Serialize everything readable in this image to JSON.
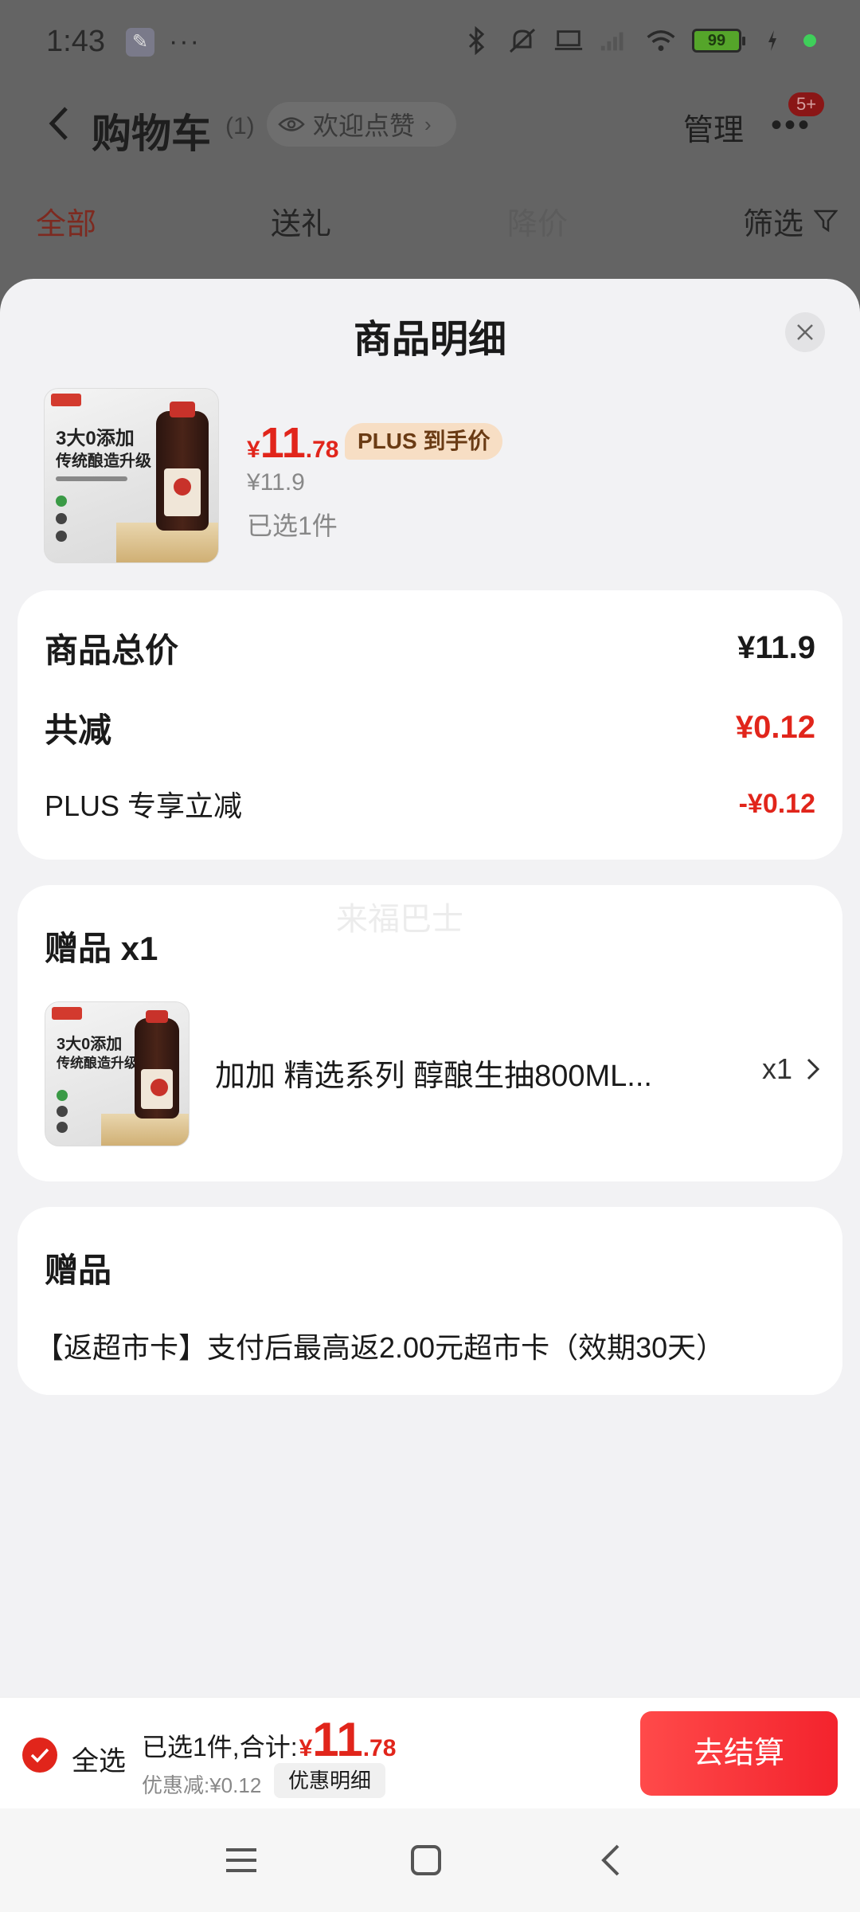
{
  "status_bar": {
    "time": "1:43",
    "battery": "99"
  },
  "nav": {
    "title": "购物车",
    "count": "(1)",
    "welcome": "欢迎点赞",
    "manage": "管理",
    "badge": "5+"
  },
  "tabs": {
    "all": "全部",
    "gift": "送礼",
    "price_drop": "降价",
    "filter": "筛选"
  },
  "sheet": {
    "title": "商品明细",
    "product": {
      "price_symbol": "¥",
      "price_int": "11",
      "price_dec": ".78",
      "plus_tag": "PLUS 到手价",
      "original_price": "¥11.9",
      "selected": "已选1件",
      "image_text_1": "3大0添加",
      "image_text_2": "传统酿造升级"
    },
    "summary": {
      "total_label": "商品总价",
      "total_value": "¥11.9",
      "reduce_label": "共减",
      "reduce_value": "¥0.12",
      "plus_label": "PLUS 专享立减",
      "plus_value": "-¥0.12"
    },
    "gift": {
      "title": "赠品 x1",
      "watermark": "来福巴士",
      "name": "加加 精选系列 醇酿生抽800ML...",
      "qty": "x1"
    },
    "promo": {
      "title": "赠品",
      "text": "【返超市卡】支付后最高返2.00元超市卡（效期30天）"
    }
  },
  "checkout": {
    "select_all": "全选",
    "total_label": "已选1件,合计:",
    "total_symbol": "¥",
    "total_int": "11",
    "total_dec": ".78",
    "discount": "优惠减:¥0.12",
    "discount_detail": "优惠明细",
    "button": "去结算"
  },
  "colors": {
    "accent": "#e1251b",
    "plus_tag_bg": "#f7dec4"
  }
}
